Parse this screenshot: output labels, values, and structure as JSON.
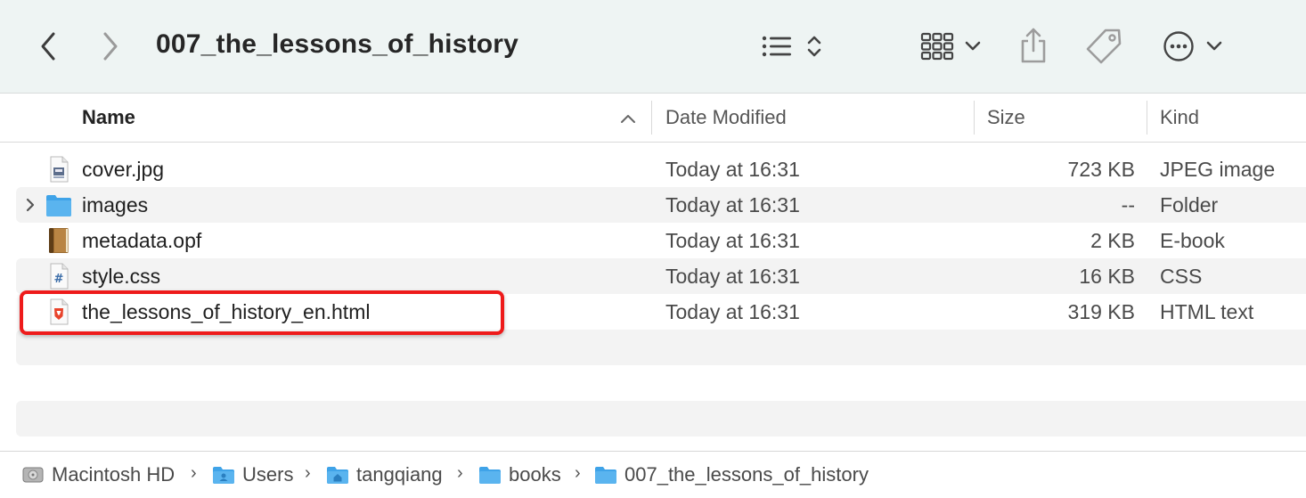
{
  "toolbar": {
    "title": "007_the_lessons_of_history",
    "icons": [
      "chevron-left-icon",
      "chevron-right-icon",
      "list-view-icon",
      "sort-updown-icon",
      "grid-view-icon",
      "chevron-down-icon",
      "share-icon",
      "tag-icon",
      "more-ellipsis-icon",
      "chevron-down-icon"
    ]
  },
  "columns": {
    "name": "Name",
    "date": "Date Modified",
    "size": "Size",
    "kind": "Kind",
    "sort": "ascending"
  },
  "files": [
    {
      "name": "cover.jpg",
      "date": "Today at 16:31",
      "size": "723 KB",
      "kind": "JPEG image",
      "icon": "jpeg-file-icon"
    },
    {
      "name": "images",
      "date": "Today at 16:31",
      "size": "--",
      "kind": "Folder",
      "icon": "folder-icon"
    },
    {
      "name": "metadata.opf",
      "date": "Today at 16:31",
      "size": "2 KB",
      "kind": "E-book",
      "icon": "ebook-file-icon"
    },
    {
      "name": "style.css",
      "date": "Today at 16:31",
      "size": "16 KB",
      "kind": "CSS",
      "icon": "css-file-icon"
    },
    {
      "name": "the_lessons_of_history_en.html",
      "date": "Today at 16:31",
      "size": "319 KB",
      "kind": "HTML text",
      "icon": "html-file-icon"
    }
  ],
  "path": [
    {
      "label": "Macintosh HD",
      "icon": "hard-drive-icon"
    },
    {
      "label": "Users",
      "icon": "users-folder-icon"
    },
    {
      "label": "tangqiang",
      "icon": "home-folder-icon"
    },
    {
      "label": "books",
      "icon": "folder-icon"
    },
    {
      "label": "007_the_lessons_of_history",
      "icon": "folder-icon"
    }
  ],
  "colors": {
    "toolbar_bg": "#eef4f3",
    "highlight": "#ee1b1b",
    "folder_blue": "#3fa3e8"
  }
}
